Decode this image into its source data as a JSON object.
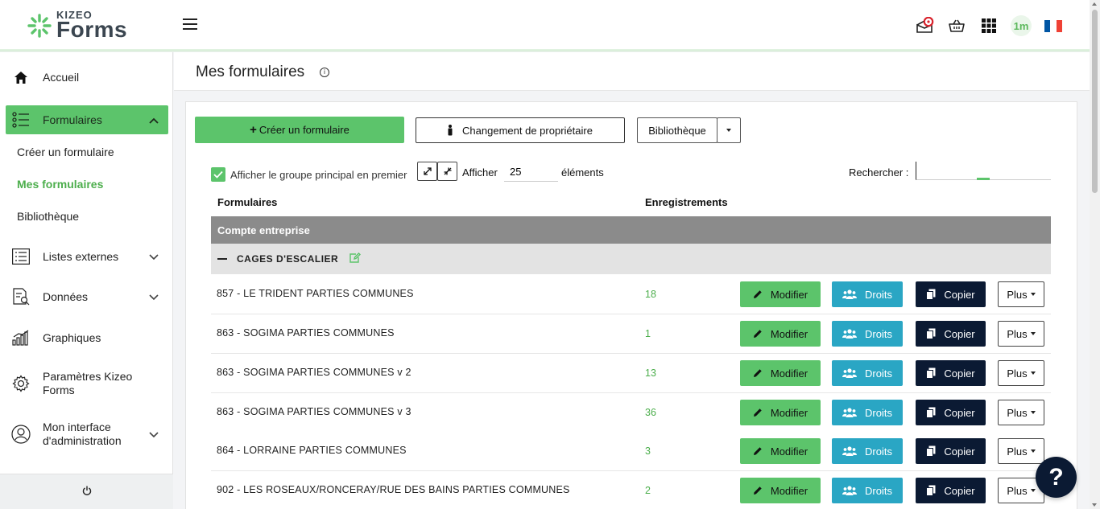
{
  "app": {
    "logo_small": "KIZEO",
    "logo_big": "Forms"
  },
  "topbar": {
    "avatar_text": "1m",
    "icons": [
      "notification-icon",
      "basket-icon",
      "apps-grid-icon",
      "avatar",
      "flag-fr-icon"
    ],
    "flag_colors": [
      "#0055a4",
      "#ffffff",
      "#ef4135"
    ]
  },
  "sidebar": {
    "items": [
      {
        "label": "Accueil",
        "icon": "home-icon"
      },
      {
        "label": "Formulaires",
        "icon": "form-list-icon"
      },
      {
        "label": "Listes externes",
        "icon": "list-icon"
      },
      {
        "label": "Données",
        "icon": "data-icon"
      },
      {
        "label": "Graphiques",
        "icon": "chart-icon"
      },
      {
        "label": "Paramètres Kizeo Forms",
        "icon": "gear-icon"
      },
      {
        "label": "Mon interface d'administration",
        "icon": "user-icon"
      }
    ],
    "sub_items": [
      {
        "label": "Créer un formulaire",
        "active": false
      },
      {
        "label": "Mes formulaires",
        "active": true
      },
      {
        "label": "Bibliothèque",
        "active": false
      }
    ],
    "footer_icon": "power-icon"
  },
  "page": {
    "title": "Mes formulaires",
    "info_icon": "i"
  },
  "toolbar": {
    "create_label": "Créer un formulaire",
    "owner_label": "Changement de propriétaire",
    "library_label": "Bibliothèque"
  },
  "filters": {
    "main_group_label": "Afficher le groupe principal en premier",
    "main_group_checked": true,
    "show_label": "Afficher",
    "page_size": "25",
    "elements_label": "éléments",
    "search_label": "Rechercher :",
    "search_value": ""
  },
  "table": {
    "columns": [
      "Formulaires",
      "Enregistrements"
    ],
    "group": "Compte entreprise",
    "subgroup": "CAGES D'ESCALIER",
    "actions": {
      "modify": "Modifier",
      "rights": "Droits",
      "copy": "Copier",
      "more": "Plus"
    },
    "rows": [
      {
        "name": "857 - LE TRIDENT PARTIES COMMUNES",
        "count": "18"
      },
      {
        "name": "863 - SOGIMA PARTIES COMMUNES",
        "count": "1"
      },
      {
        "name": "863 - SOGIMA PARTIES COMMUNES v 2",
        "count": "13"
      },
      {
        "name": "863 - SOGIMA PARTIES COMMUNES v 3",
        "count": "36"
      },
      {
        "name": "864 - LORRAINE PARTIES COMMUNES",
        "count": "3"
      },
      {
        "name": "902 - LES ROSEAUX/RONCERAY/RUE DES BAINS PARTIES COMMUNES",
        "count": "2"
      }
    ]
  },
  "help": {
    "label": "?"
  },
  "colors": {
    "brand_green": "#5cc46b",
    "rights_blue": "#2aa6c4",
    "copy_navy": "#0b1a33",
    "group_gray": "#8b8b8b"
  }
}
